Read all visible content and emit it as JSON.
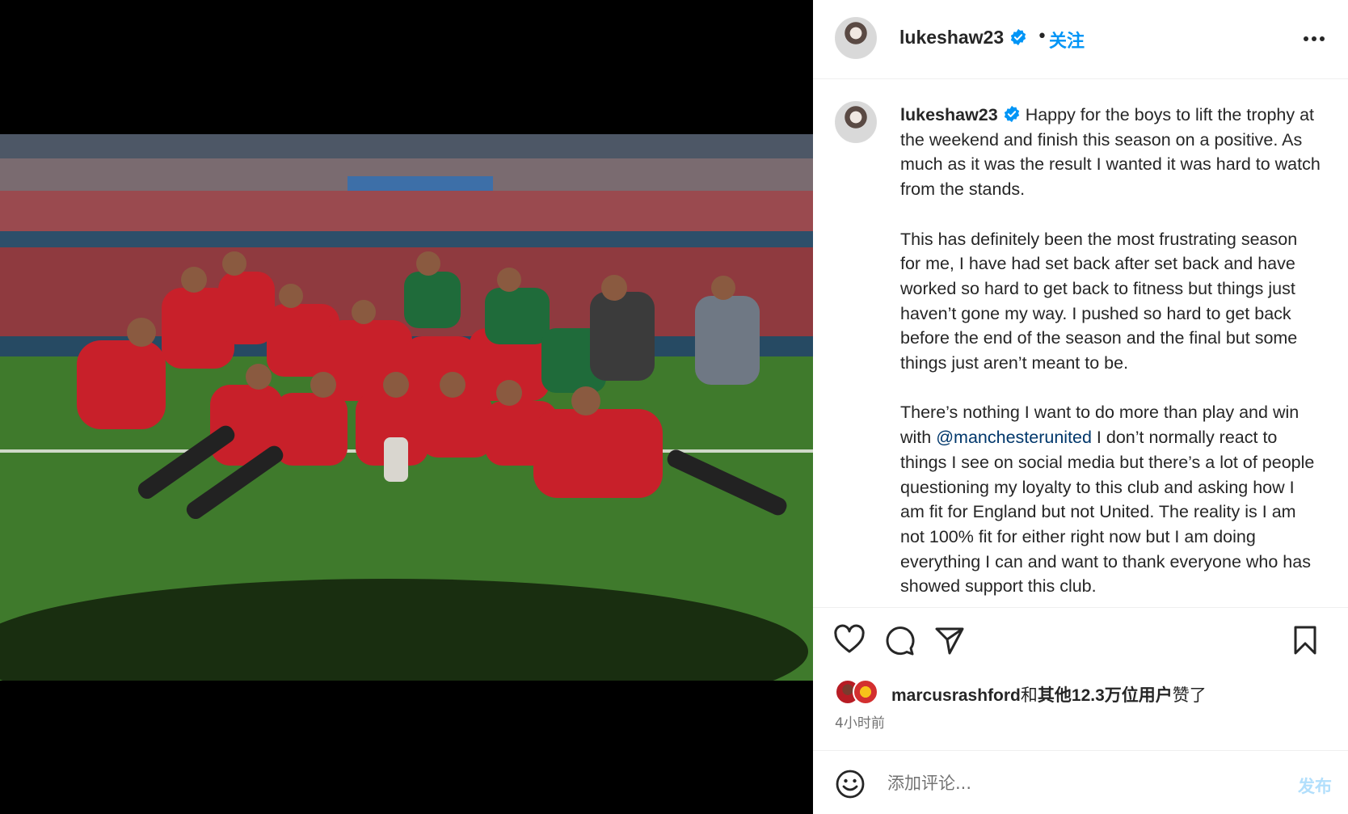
{
  "post": {
    "username": "lukeshaw23",
    "follow_label": "关注",
    "separator": "•",
    "caption": {
      "username": "lukeshaw23",
      "p1": "Happy for the boys to lift the trophy at the weekend and finish this season on a positive. As much as it was the result I wanted it was hard to watch from the stands.",
      "p2": "This has definitely been the most frustrating season for me, I have had set back after set back and have worked so hard to get back to fitness but things just haven’t gone my way. I pushed so hard to get back before the end of the season and the final but some things just aren’t meant to be.",
      "p3_before": "There’s nothing I want to do more than play and win with ",
      "p3_mention": "@manchesterunited",
      "p3_after": " I don’t normally react to things I see on social media but there’s a lot of people questioning my loyalty to this club and asking how I am fit for England but not United. The reality is I am not 100% fit for either right now but I am doing everything I can and want to thank everyone who has showed support this club."
    },
    "likes": {
      "first_user": "marcusrashford",
      "connector": "和",
      "others": "其他12.3万位用户",
      "suffix": "赞了"
    },
    "time": "4小时前",
    "comment_placeholder": "添加评论...",
    "post_label": "发布"
  },
  "icons": {
    "verified": "verified-badge-icon",
    "more": "more-options-icon",
    "like": "heart-icon",
    "comment": "comment-icon",
    "share": "share-icon",
    "save": "bookmark-icon",
    "emoji": "emoji-icon"
  },
  "colors": {
    "accent": "#0095f6",
    "mention": "#00376b",
    "post_disabled": "#b2dffc"
  }
}
